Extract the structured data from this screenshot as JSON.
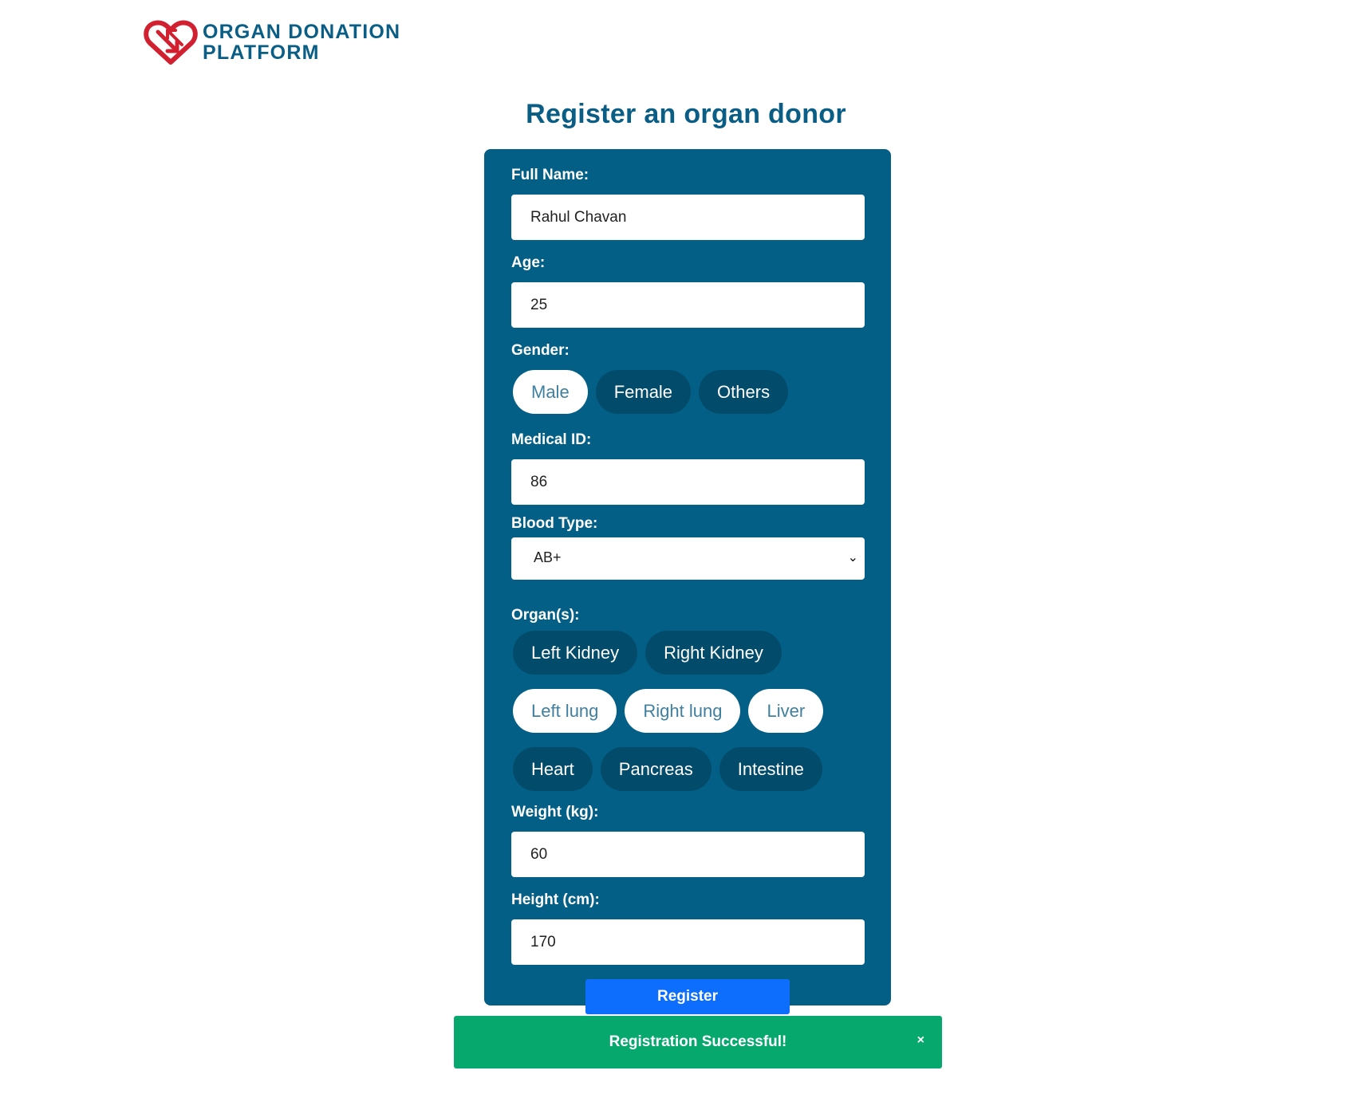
{
  "logo": {
    "line1": "ORGAN DONATION",
    "line2": "PLATFORM"
  },
  "title": "Register an organ donor",
  "form": {
    "full_name": {
      "label": "Full Name:",
      "value": "Rahul Chavan"
    },
    "age": {
      "label": "Age:",
      "value": "25"
    },
    "gender": {
      "label": "Gender:",
      "options": [
        {
          "label": "Male",
          "selected": true
        },
        {
          "label": "Female",
          "selected": false
        },
        {
          "label": "Others",
          "selected": false
        }
      ]
    },
    "medical_id": {
      "label": "Medical ID:",
      "value": "86"
    },
    "blood_type": {
      "label": "Blood Type:",
      "value": "AB+"
    },
    "organs": {
      "label": "Organ(s):",
      "rows": [
        [
          {
            "label": "Left Kidney",
            "selected": false
          },
          {
            "label": "Right Kidney",
            "selected": false
          }
        ],
        [
          {
            "label": "Left lung",
            "selected": true
          },
          {
            "label": "Right lung",
            "selected": true
          },
          {
            "label": "Liver",
            "selected": true
          }
        ],
        [
          {
            "label": "Heart",
            "selected": false
          },
          {
            "label": "Pancreas",
            "selected": false
          },
          {
            "label": "Intestine",
            "selected": false
          }
        ]
      ]
    },
    "weight": {
      "label": "Weight (kg):",
      "value": "60"
    },
    "height": {
      "label": "Height (cm):",
      "value": "170"
    },
    "submit_label": "Register"
  },
  "toast": {
    "message": "Registration Successful!",
    "close": "×"
  },
  "colors": {
    "brand": "#0a5e85",
    "card": "#045f86",
    "pill_unselected": "#024b6b",
    "button": "#0d6efd",
    "success": "#06a86e",
    "logo_red": "#d1202f"
  }
}
